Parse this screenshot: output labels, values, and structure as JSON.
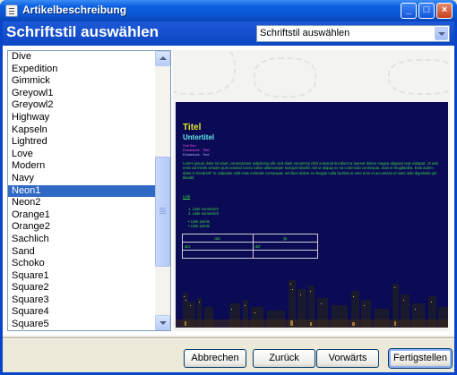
{
  "window": {
    "title": "Artikelbeschreibung"
  },
  "header": {
    "title": "Schriftstil auswählen",
    "select_value": "Schriftstil auswählen"
  },
  "style_list": {
    "selected": "Neon1",
    "items": [
      "Dive",
      "Expedition",
      "Gimmick",
      "Greyowl1",
      "Greyowl2",
      "Highway",
      "Kapseln",
      "Lightred",
      "Love",
      "Modern",
      "Navy",
      "Neon1",
      "Neon2",
      "Orange1",
      "Orange2",
      "Sachlich",
      "Sand",
      "Schoko",
      "Square1",
      "Square2",
      "Square3",
      "Square4",
      "Square5"
    ]
  },
  "preview": {
    "title": "Titel",
    "subtitle": "Untertitel",
    "subtitle2": "SubTitel",
    "block_title": "Extrablock - Titel",
    "block_text": "Extrablock - Text",
    "body": "Lorem ipsum dolor sit amet, consectetuer adipiscing elit, sed diam nonummy nibh euismod tincidunt ut laoreet dolore magna aliquam erat volutpat. Ut wisi enim ad minim veniam quis nostrud exerci tution ullamcorper suscipit lobortis nisl ut aliquip ex ea commodo consequat. Duis te feugifacilisi. Duis autem dolor in hendrerit\" in vulputate velit esse molestie consequat, vel illum dolore eu feugiat nulla facilisis at vero eros et accumsan et iusto odio dignissim qui blandit.",
    "link": "Link",
    "numbered_list": [
      "Liste numerisch",
      "Liste numerisch"
    ],
    "bullet_list": [
      "Liste points",
      "Liste points"
    ],
    "table": {
      "headers": [
        "abc",
        "ijk"
      ],
      "rows": [
        [
          "abc",
          "def"
        ],
        [
          "",
          ""
        ]
      ]
    }
  },
  "buttons": {
    "cancel": "Abbrechen",
    "back": "Zurück",
    "next": "Vorwärts",
    "finish": "Fertigstellen"
  },
  "colors": {
    "title_bar": "#0a5ad8",
    "header_blue": "#0c46c3",
    "selection": "#316ac5",
    "preview_background": "#0a0a55",
    "preview_title": "#e8e828",
    "preview_subtitle": "#63e8e8",
    "preview_text": "#3fd63f"
  }
}
